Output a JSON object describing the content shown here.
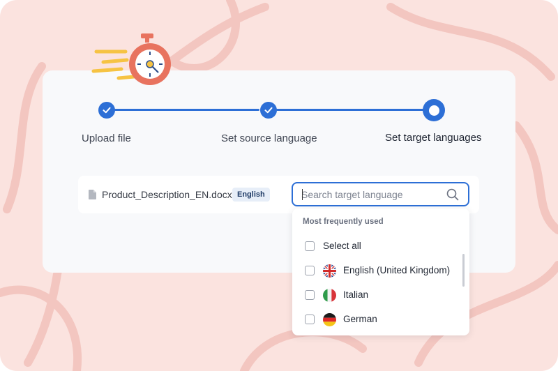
{
  "stepper": {
    "steps": [
      {
        "label": "Upload file",
        "state": "completed"
      },
      {
        "label": "Set source language",
        "state": "completed"
      },
      {
        "label": "Set target languages",
        "state": "current"
      }
    ]
  },
  "file": {
    "name": "Product_Description_EN.docx",
    "source_language_badge": "English"
  },
  "search": {
    "placeholder": "Search target language",
    "value": ""
  },
  "dropdown": {
    "heading": "Most frequently used",
    "options": [
      {
        "label": "Select all",
        "checked": false,
        "icon": null
      },
      {
        "label": "English (United Kingdom)",
        "checked": false,
        "icon": "uk-flag-icon"
      },
      {
        "label": "Italian",
        "checked": false,
        "icon": "italy-flag-icon"
      },
      {
        "label": "German",
        "checked": false,
        "icon": "germany-flag-icon"
      }
    ]
  },
  "colors": {
    "accent": "#2d6fd6",
    "background": "#fbe3df",
    "card": "#f8f9fb",
    "stopwatch": "#e8735f"
  }
}
